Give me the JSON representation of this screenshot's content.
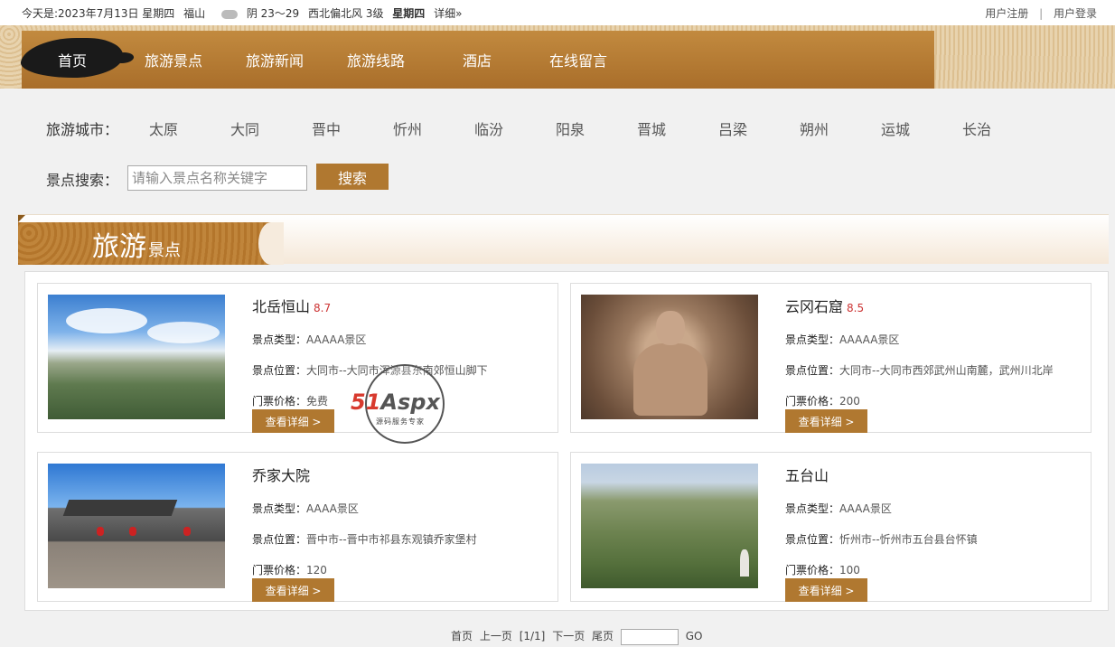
{
  "topbar": {
    "date": "今天是:2023年7月13日 星期四",
    "city": "福山",
    "weather": "阴 23～29",
    "wind": "西北偏北风 3级",
    "weekday": "星期四",
    "more": "详细»",
    "register": "用户注册",
    "separator": "|",
    "login": "用户登录"
  },
  "nav": {
    "items": [
      {
        "label": "首页"
      },
      {
        "label": "旅游景点"
      },
      {
        "label": "旅游新闻"
      },
      {
        "label": "旅游线路"
      },
      {
        "label": "酒店"
      },
      {
        "label": "在线留言"
      }
    ]
  },
  "cities": {
    "label": "旅游城市：",
    "items": [
      "太原",
      "大同",
      "晋中",
      "忻州",
      "临汾",
      "阳泉",
      "晋城",
      "吕梁",
      "朔州",
      "运城",
      "长治"
    ]
  },
  "search": {
    "label": "景点搜索：",
    "placeholder": "请输入景点名称关键字",
    "button": "搜索"
  },
  "section": {
    "title_big": "旅游",
    "title_small": "景点"
  },
  "spots": [
    {
      "name": "北岳恒山",
      "score": "8.7",
      "type_key": "景点类型：",
      "type": "AAAAA景区",
      "loc_key": "景点位置：",
      "location": "大同市--大同市浑源县东南郊恒山脚下",
      "price_key": "门票价格：",
      "price": "免费",
      "button": "查看详细 >"
    },
    {
      "name": "云冈石窟",
      "score": "8.5",
      "type_key": "景点类型：",
      "type": "AAAAA景区",
      "loc_key": "景点位置：",
      "location": "大同市--大同市西郊武州山南麓，武州川北岸",
      "price_key": "门票价格：",
      "price": "200",
      "button": "查看详细 >"
    },
    {
      "name": "乔家大院",
      "score": "",
      "type_key": "景点类型：",
      "type": "AAAA景区",
      "loc_key": "景点位置：",
      "location": "晋中市--晋中市祁县东观镇乔家堡村",
      "price_key": "门票价格：",
      "price": "120",
      "button": "查看详细 >"
    },
    {
      "name": "五台山",
      "score": "",
      "type_key": "景点类型：",
      "type": "AAAA景区",
      "loc_key": "景点位置：",
      "location": "忻州市--忻州市五台县台怀镇",
      "price_key": "门票价格：",
      "price": "100",
      "button": "查看详细 >"
    }
  ],
  "watermark": {
    "brand_red": "51",
    "brand_gray": "Aspx",
    "slogan": "源码服务专家"
  },
  "pager": {
    "first": "首页",
    "prev": "上一页",
    "current": "[1/1]",
    "next": "下一页",
    "last": "尾页",
    "go": "GO"
  },
  "colors": {
    "accent": "#b07830",
    "score": "#cc3333"
  }
}
